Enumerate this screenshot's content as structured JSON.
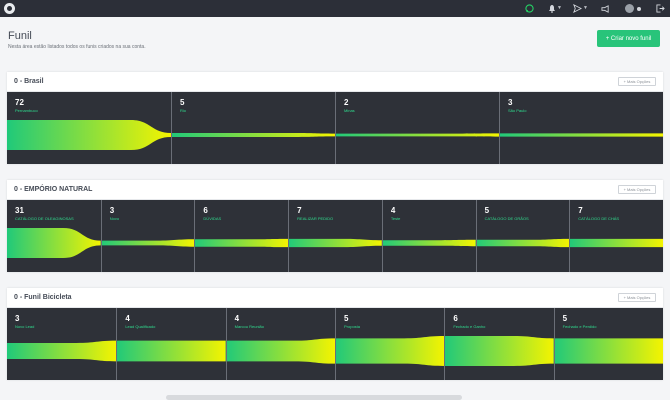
{
  "colors": {
    "topbar": "#2c2f38",
    "accent": "#28c47a",
    "funnel_start": "#20c97a",
    "funnel_end": "#f4f400",
    "stage_label": "#2fdd8f",
    "panel": "#2e3138"
  },
  "topbar": {
    "icons": [
      "app-logo-icon",
      "whatsapp-icon",
      "bell-icon",
      "send-icon",
      "megaphone-icon",
      "avatar",
      "logout-icon"
    ]
  },
  "page": {
    "title": "Funil",
    "subtitle": "Nesta área estão listados todos os funis criados na sua conta.",
    "new_button": "+ Criar novo funil"
  },
  "funnels": [
    {
      "title": "0 - Brasil",
      "more_label": "+ Mais Opções",
      "stages": [
        {
          "count": "72",
          "name": "Pernambuco"
        },
        {
          "count": "5",
          "name": "Rio"
        },
        {
          "count": "2",
          "name": "Minas"
        },
        {
          "count": "3",
          "name": "São Paulo"
        }
      ]
    },
    {
      "title": "0 - EMPÓRIO NATURAL",
      "more_label": "+ Mais Opções",
      "stages": [
        {
          "count": "31",
          "name": "CATÁLOGO DE OLEAGINOSAS"
        },
        {
          "count": "3",
          "name": "Novo"
        },
        {
          "count": "6",
          "name": "DÚVIDAS"
        },
        {
          "count": "7",
          "name": "REALIZAR PEDIDO"
        },
        {
          "count": "4",
          "name": "Teste"
        },
        {
          "count": "5",
          "name": "CATÁLOGO DE GRÃOS"
        },
        {
          "count": "7",
          "name": "CATÁLOGO DE CHÁS"
        }
      ]
    },
    {
      "title": "0 - Funil Bicicleta",
      "more_label": "+ Mais Opções",
      "stages": [
        {
          "count": "3",
          "name": "Novo Lead"
        },
        {
          "count": "4",
          "name": "Lead Qualificado"
        },
        {
          "count": "4",
          "name": "Marcou Reunião"
        },
        {
          "count": "5",
          "name": "Proposta"
        },
        {
          "count": "6",
          "name": "Fechado e Ganho"
        },
        {
          "count": "5",
          "name": "Fechado e Perdido"
        }
      ]
    }
  ]
}
